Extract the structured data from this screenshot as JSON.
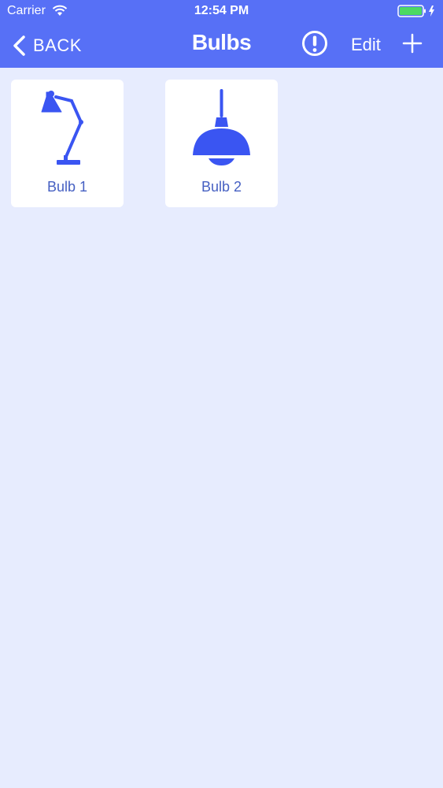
{
  "status_bar": {
    "carrier": "Carrier",
    "time": "12:54 PM",
    "battery_color": "#4CD964"
  },
  "nav": {
    "back_label": "BACK",
    "title": "Bulbs",
    "alert_icon": "exclamation-circle-icon",
    "edit_label": "Edit",
    "add_icon": "plus-icon"
  },
  "bulbs": [
    {
      "label": "Bulb 1",
      "icon": "desk-lamp-icon"
    },
    {
      "label": "Bulb 2",
      "icon": "pendant-lamp-icon"
    }
  ],
  "colors": {
    "accent": "#5770F6",
    "background": "#E7ECFE",
    "icon": "#3A55F2",
    "label": "#4660C2"
  }
}
